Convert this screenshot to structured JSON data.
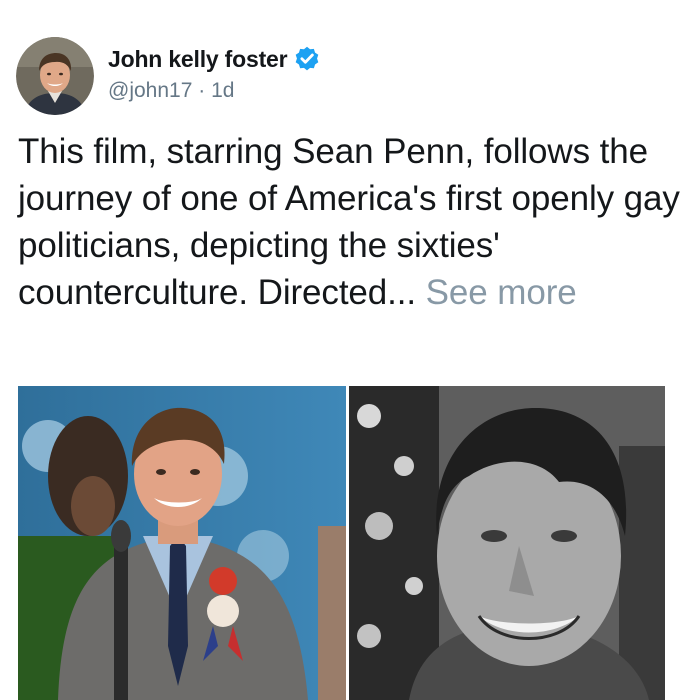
{
  "tweet": {
    "author": {
      "display_name": "John kelly foster",
      "handle": "@john17",
      "separator": "·",
      "age": "1d",
      "verified": true,
      "avatar_icon": "profile-photo"
    },
    "text_main": "This film, starring Sean Penn, follows the journey of one of America's first openly gay politicians, depicting the sixties' counterculture. Directed...",
    "see_more_label": "See more",
    "media": [
      {
        "icon": "photo-actor-at-podium"
      },
      {
        "icon": "photo-black-and-white-portrait"
      }
    ]
  },
  "colors": {
    "name_text": "#14171a",
    "secondary_text": "#657786",
    "see_more": "#8899a6",
    "verified_badge": "#1da1f2"
  }
}
